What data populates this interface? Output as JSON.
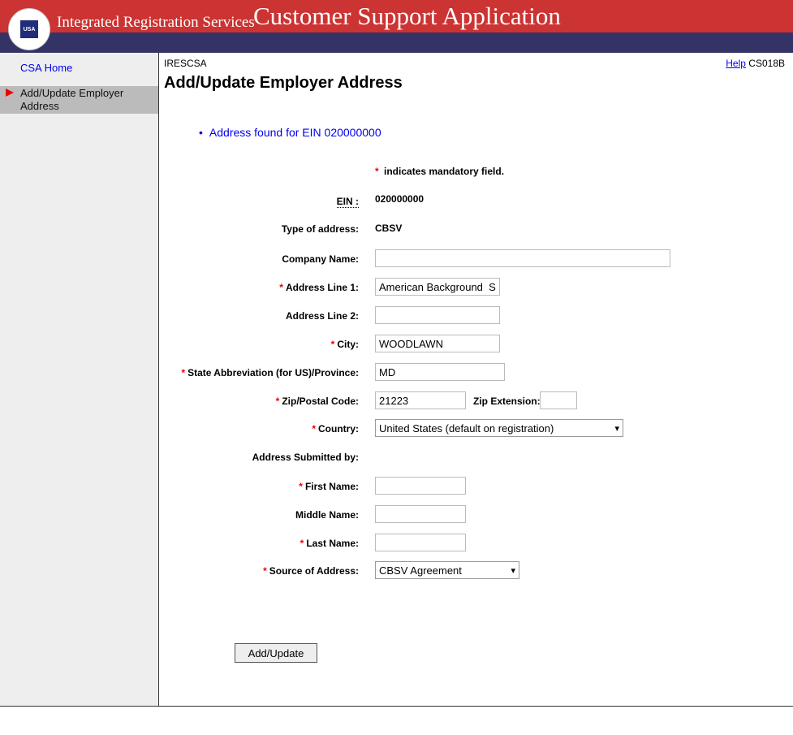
{
  "header": {
    "logo_text": "USA",
    "org": "Integrated Registration Services",
    "app_title": "Customer Support Application"
  },
  "sidebar": {
    "home": "CSA Home",
    "active": "Add/Update Employer Address"
  },
  "page": {
    "code": "IRESCSA",
    "help": "Help",
    "screen_id": "CS018B",
    "title": "Add/Update Employer Address",
    "message": "Address found for EIN 020000000",
    "mandatory_note": "indicates mandatory field.",
    "star": "*"
  },
  "form": {
    "ein_label": "EIN :",
    "ein": "020000000",
    "type_label": "Type of address:",
    "type": "CBSV",
    "company_label": "Company Name:",
    "company": "",
    "addr1_label": "Address Line 1:",
    "addr1": "American Background  S",
    "addr2_label": "Address Line 2:",
    "addr2": "",
    "city_label": "City:",
    "city": "WOODLAWN",
    "state_label": "State Abbreviation (for US)/Province:",
    "state": "MD",
    "zip_label": "Zip/Postal Code:",
    "zip": "21223",
    "zipext_label": "Zip Extension:",
    "zipext": "",
    "country_label": "Country:",
    "country": "United States (default on registration)",
    "submitted_label": "Address Submitted by:",
    "first_label": "First Name:",
    "first": "",
    "middle_label": "Middle Name:",
    "middle": "",
    "last_label": "Last Name:",
    "last": "",
    "source_label": "Source of Address:",
    "source": "CBSV Agreement",
    "submit": "Add/Update"
  }
}
